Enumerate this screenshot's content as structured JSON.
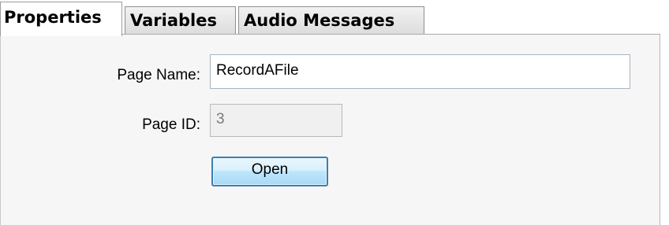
{
  "tabs": [
    {
      "label": "Properties",
      "active": true
    },
    {
      "label": "Variables",
      "active": false
    },
    {
      "label": "Audio Messages",
      "active": false
    }
  ],
  "form": {
    "page_name_label": "Page Name:",
    "page_name_value": "RecordAFile",
    "page_id_label": "Page ID:",
    "page_id_value": "3",
    "open_button_label": "Open"
  },
  "colors": {
    "button_border": "#3c7fb1",
    "panel_background": "#f6f6f6"
  }
}
